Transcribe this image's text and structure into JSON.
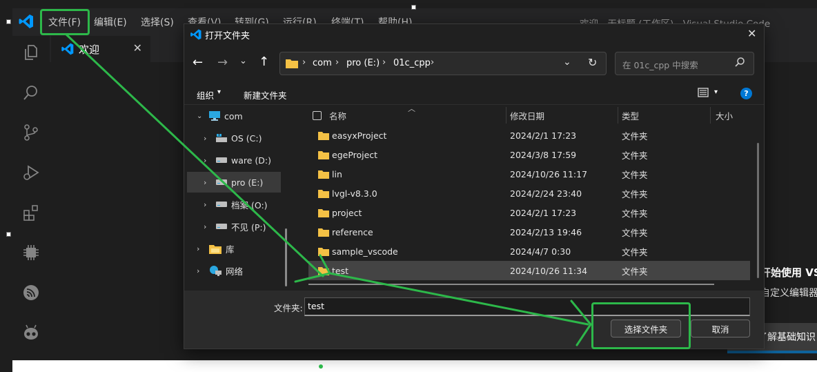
{
  "window": {
    "title": "欢迎 - 无标题 (工作区) - Visual Studio Code"
  },
  "menu": [
    {
      "label": "文件(F)"
    },
    {
      "label": "编辑(E)"
    },
    {
      "label": "选择(S)"
    },
    {
      "label": "查看(V)"
    },
    {
      "label": "转到(G)"
    },
    {
      "label": "运行(R)"
    },
    {
      "label": "终端(T)"
    },
    {
      "label": "帮助(H)"
    }
  ],
  "editor": {
    "tab_label": "欢迎",
    "welcome_heading": "开始使用 VS",
    "welcome_sub": "自定义编辑器",
    "welcome_learn": "了解基础知识"
  },
  "dialog": {
    "title": "打开文件夹",
    "breadcrumb": [
      "com",
      "pro (E:)",
      "01c_cpp"
    ],
    "search_placeholder": "在 01c_cpp 中搜索",
    "organize_label": "组织",
    "new_folder_label": "新建文件夹",
    "help_glyph": "?",
    "nav_tree": [
      {
        "label": "com",
        "icon": "desktop-icon",
        "expanded": true
      },
      {
        "label": "OS (C:)",
        "icon": "os-drive-icon"
      },
      {
        "label": "ware (D:)",
        "icon": "drive-icon"
      },
      {
        "label": "pro (E:)",
        "icon": "drive-icon",
        "selected": true
      },
      {
        "label": "档案 (O:)",
        "icon": "drive-icon"
      },
      {
        "label": "不见 (P:)",
        "icon": "drive-icon"
      },
      {
        "label": "库",
        "icon": "library-icon"
      },
      {
        "label": "网络",
        "icon": "network-icon"
      }
    ],
    "columns": {
      "name": "名称",
      "modified": "修改日期",
      "type": "类型",
      "size": "大小"
    },
    "files": [
      {
        "name": "easyxProject",
        "modified": "2024/2/1 17:23",
        "type": "文件夹"
      },
      {
        "name": "egeProject",
        "modified": "2024/3/8 17:59",
        "type": "文件夹"
      },
      {
        "name": "lin",
        "modified": "2024/10/26 11:17",
        "type": "文件夹"
      },
      {
        "name": "lvgl-v8.3.0",
        "modified": "2024/2/24 23:40",
        "type": "文件夹"
      },
      {
        "name": "project",
        "modified": "2024/2/1 17:23",
        "type": "文件夹"
      },
      {
        "name": "reference",
        "modified": "2024/2/13 19:46",
        "type": "文件夹"
      },
      {
        "name": "sample_vscode",
        "modified": "2024/4/7 0:30",
        "type": "文件夹"
      },
      {
        "name": "test",
        "modified": "2024/10/26 11:34",
        "type": "文件夹",
        "selected": true
      }
    ],
    "folder_label": "文件夹:",
    "folder_value": "test",
    "select_button": "选择文件夹",
    "cancel_button": "取消"
  },
  "colors": {
    "accent_vscode_blue": "#0098ff",
    "annotation_green": "#2db84a",
    "folder_yellow": "#f4c145"
  }
}
